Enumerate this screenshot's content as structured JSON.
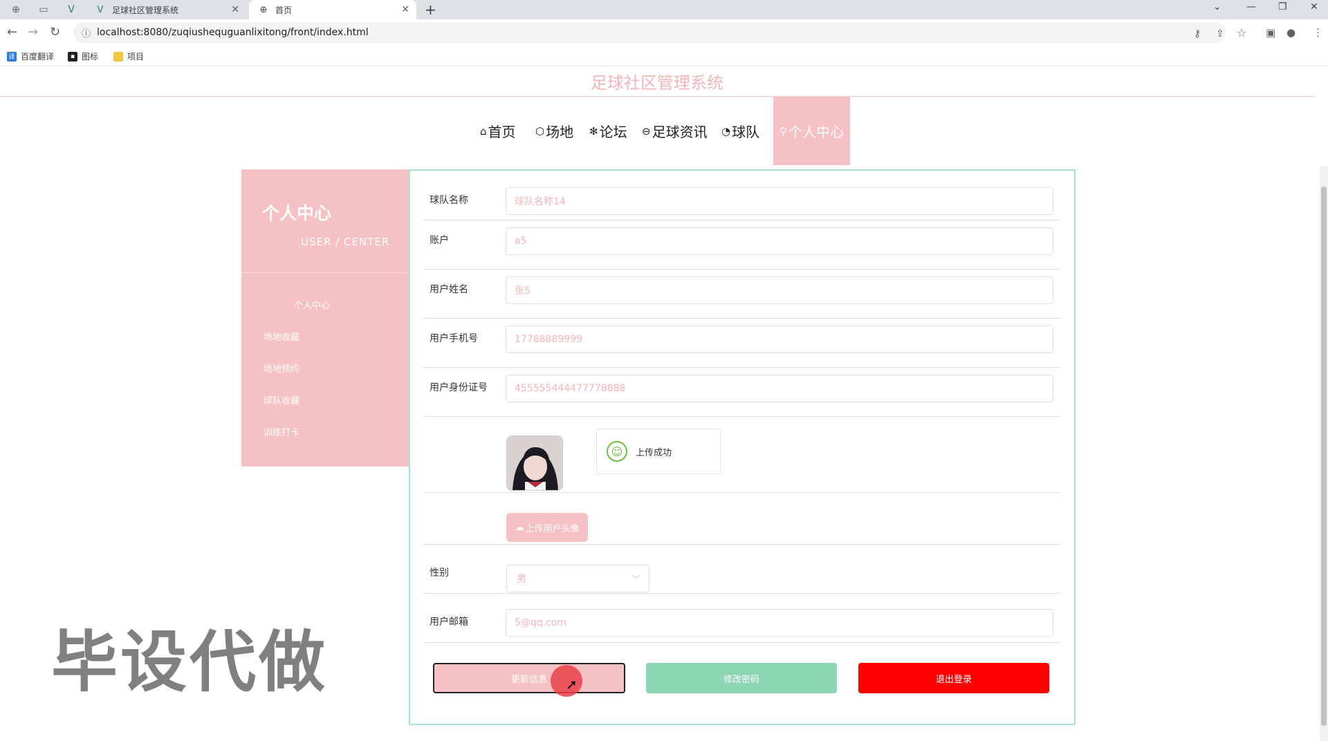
{
  "browser": {
    "tabs": [
      {
        "title": "足球社区管理系统",
        "active": false
      },
      {
        "title": "首页",
        "active": true
      }
    ],
    "new_tab": "+",
    "url": "localhost:8080/zuqiushequguanlixitong/front/index.html",
    "bookmarks": [
      "百度翻译",
      "图标",
      "项目"
    ]
  },
  "site": {
    "title": "足球社区管理系统"
  },
  "nav": {
    "items": [
      {
        "label": "首页",
        "icon": "home-icon",
        "glyph": "⌂"
      },
      {
        "label": "场地",
        "icon": "cube-icon",
        "glyph": "⬡"
      },
      {
        "label": "论坛",
        "icon": "snowflake-icon",
        "glyph": "✻"
      },
      {
        "label": "足球资讯",
        "icon": "ball-icon",
        "glyph": "⊖"
      },
      {
        "label": "球队",
        "icon": "gauge-icon",
        "glyph": "◔"
      },
      {
        "label": "个人中心",
        "icon": "user-icon",
        "glyph": "⚲",
        "active": true
      }
    ]
  },
  "sidebar": {
    "title": "个人中心",
    "subtitle": "USER / CENTER",
    "items": [
      "个人中心",
      "场地收藏",
      "场地预约",
      "球队收藏",
      "训练打卡"
    ]
  },
  "form": {
    "team_name": {
      "label": "球队名称",
      "value": "球队名称14"
    },
    "account": {
      "label": "账户",
      "value": "a5"
    },
    "user_name": {
      "label": "用户姓名",
      "value": "张5"
    },
    "phone": {
      "label": "用户手机号",
      "value": "17788889999"
    },
    "id_number": {
      "label": "用户身份证号",
      "value": "455555444477778888"
    },
    "upload_toast": "上传成功",
    "upload_button": "上传用户头像",
    "gender": {
      "label": "性别",
      "value": "男"
    },
    "email": {
      "label": "用户邮箱",
      "value": "5@qq.com"
    }
  },
  "actions": {
    "update": "更新信息",
    "change_password": "修改密码",
    "logout": "退出登录"
  },
  "watermark": "毕设代做",
  "colors": {
    "accent_pink": "#f6c1c4",
    "mint": "#8cd5b5",
    "logout_red": "#ff0000",
    "panel_border": "#a7e0cf"
  }
}
